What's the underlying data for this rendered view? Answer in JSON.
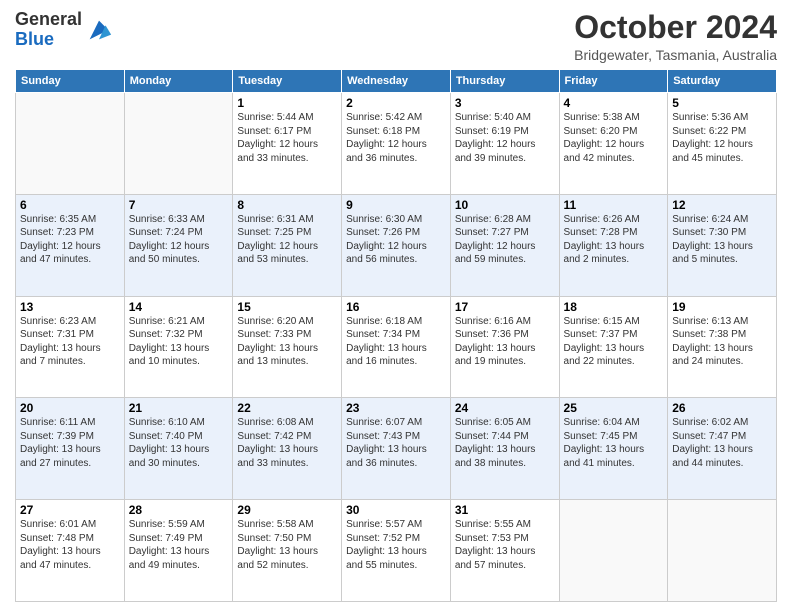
{
  "logo": {
    "general": "General",
    "blue": "Blue"
  },
  "header": {
    "title": "October 2024",
    "location": "Bridgewater, Tasmania, Australia"
  },
  "weekdays": [
    "Sunday",
    "Monday",
    "Tuesday",
    "Wednesday",
    "Thursday",
    "Friday",
    "Saturday"
  ],
  "weeks": [
    [
      {
        "day": "",
        "sunrise": "",
        "sunset": "",
        "daylight": ""
      },
      {
        "day": "",
        "sunrise": "",
        "sunset": "",
        "daylight": ""
      },
      {
        "day": "1",
        "sunrise": "Sunrise: 5:44 AM",
        "sunset": "Sunset: 6:17 PM",
        "daylight": "Daylight: 12 hours and 33 minutes."
      },
      {
        "day": "2",
        "sunrise": "Sunrise: 5:42 AM",
        "sunset": "Sunset: 6:18 PM",
        "daylight": "Daylight: 12 hours and 36 minutes."
      },
      {
        "day": "3",
        "sunrise": "Sunrise: 5:40 AM",
        "sunset": "Sunset: 6:19 PM",
        "daylight": "Daylight: 12 hours and 39 minutes."
      },
      {
        "day": "4",
        "sunrise": "Sunrise: 5:38 AM",
        "sunset": "Sunset: 6:20 PM",
        "daylight": "Daylight: 12 hours and 42 minutes."
      },
      {
        "day": "5",
        "sunrise": "Sunrise: 5:36 AM",
        "sunset": "Sunset: 6:22 PM",
        "daylight": "Daylight: 12 hours and 45 minutes."
      }
    ],
    [
      {
        "day": "6",
        "sunrise": "Sunrise: 6:35 AM",
        "sunset": "Sunset: 7:23 PM",
        "daylight": "Daylight: 12 hours and 47 minutes."
      },
      {
        "day": "7",
        "sunrise": "Sunrise: 6:33 AM",
        "sunset": "Sunset: 7:24 PM",
        "daylight": "Daylight: 12 hours and 50 minutes."
      },
      {
        "day": "8",
        "sunrise": "Sunrise: 6:31 AM",
        "sunset": "Sunset: 7:25 PM",
        "daylight": "Daylight: 12 hours and 53 minutes."
      },
      {
        "day": "9",
        "sunrise": "Sunrise: 6:30 AM",
        "sunset": "Sunset: 7:26 PM",
        "daylight": "Daylight: 12 hours and 56 minutes."
      },
      {
        "day": "10",
        "sunrise": "Sunrise: 6:28 AM",
        "sunset": "Sunset: 7:27 PM",
        "daylight": "Daylight: 12 hours and 59 minutes."
      },
      {
        "day": "11",
        "sunrise": "Sunrise: 6:26 AM",
        "sunset": "Sunset: 7:28 PM",
        "daylight": "Daylight: 13 hours and 2 minutes."
      },
      {
        "day": "12",
        "sunrise": "Sunrise: 6:24 AM",
        "sunset": "Sunset: 7:30 PM",
        "daylight": "Daylight: 13 hours and 5 minutes."
      }
    ],
    [
      {
        "day": "13",
        "sunrise": "Sunrise: 6:23 AM",
        "sunset": "Sunset: 7:31 PM",
        "daylight": "Daylight: 13 hours and 7 minutes."
      },
      {
        "day": "14",
        "sunrise": "Sunrise: 6:21 AM",
        "sunset": "Sunset: 7:32 PM",
        "daylight": "Daylight: 13 hours and 10 minutes."
      },
      {
        "day": "15",
        "sunrise": "Sunrise: 6:20 AM",
        "sunset": "Sunset: 7:33 PM",
        "daylight": "Daylight: 13 hours and 13 minutes."
      },
      {
        "day": "16",
        "sunrise": "Sunrise: 6:18 AM",
        "sunset": "Sunset: 7:34 PM",
        "daylight": "Daylight: 13 hours and 16 minutes."
      },
      {
        "day": "17",
        "sunrise": "Sunrise: 6:16 AM",
        "sunset": "Sunset: 7:36 PM",
        "daylight": "Daylight: 13 hours and 19 minutes."
      },
      {
        "day": "18",
        "sunrise": "Sunrise: 6:15 AM",
        "sunset": "Sunset: 7:37 PM",
        "daylight": "Daylight: 13 hours and 22 minutes."
      },
      {
        "day": "19",
        "sunrise": "Sunrise: 6:13 AM",
        "sunset": "Sunset: 7:38 PM",
        "daylight": "Daylight: 13 hours and 24 minutes."
      }
    ],
    [
      {
        "day": "20",
        "sunrise": "Sunrise: 6:11 AM",
        "sunset": "Sunset: 7:39 PM",
        "daylight": "Daylight: 13 hours and 27 minutes."
      },
      {
        "day": "21",
        "sunrise": "Sunrise: 6:10 AM",
        "sunset": "Sunset: 7:40 PM",
        "daylight": "Daylight: 13 hours and 30 minutes."
      },
      {
        "day": "22",
        "sunrise": "Sunrise: 6:08 AM",
        "sunset": "Sunset: 7:42 PM",
        "daylight": "Daylight: 13 hours and 33 minutes."
      },
      {
        "day": "23",
        "sunrise": "Sunrise: 6:07 AM",
        "sunset": "Sunset: 7:43 PM",
        "daylight": "Daylight: 13 hours and 36 minutes."
      },
      {
        "day": "24",
        "sunrise": "Sunrise: 6:05 AM",
        "sunset": "Sunset: 7:44 PM",
        "daylight": "Daylight: 13 hours and 38 minutes."
      },
      {
        "day": "25",
        "sunrise": "Sunrise: 6:04 AM",
        "sunset": "Sunset: 7:45 PM",
        "daylight": "Daylight: 13 hours and 41 minutes."
      },
      {
        "day": "26",
        "sunrise": "Sunrise: 6:02 AM",
        "sunset": "Sunset: 7:47 PM",
        "daylight": "Daylight: 13 hours and 44 minutes."
      }
    ],
    [
      {
        "day": "27",
        "sunrise": "Sunrise: 6:01 AM",
        "sunset": "Sunset: 7:48 PM",
        "daylight": "Daylight: 13 hours and 47 minutes."
      },
      {
        "day": "28",
        "sunrise": "Sunrise: 5:59 AM",
        "sunset": "Sunset: 7:49 PM",
        "daylight": "Daylight: 13 hours and 49 minutes."
      },
      {
        "day": "29",
        "sunrise": "Sunrise: 5:58 AM",
        "sunset": "Sunset: 7:50 PM",
        "daylight": "Daylight: 13 hours and 52 minutes."
      },
      {
        "day": "30",
        "sunrise": "Sunrise: 5:57 AM",
        "sunset": "Sunset: 7:52 PM",
        "daylight": "Daylight: 13 hours and 55 minutes."
      },
      {
        "day": "31",
        "sunrise": "Sunrise: 5:55 AM",
        "sunset": "Sunset: 7:53 PM",
        "daylight": "Daylight: 13 hours and 57 minutes."
      },
      {
        "day": "",
        "sunrise": "",
        "sunset": "",
        "daylight": ""
      },
      {
        "day": "",
        "sunrise": "",
        "sunset": "",
        "daylight": ""
      }
    ]
  ]
}
